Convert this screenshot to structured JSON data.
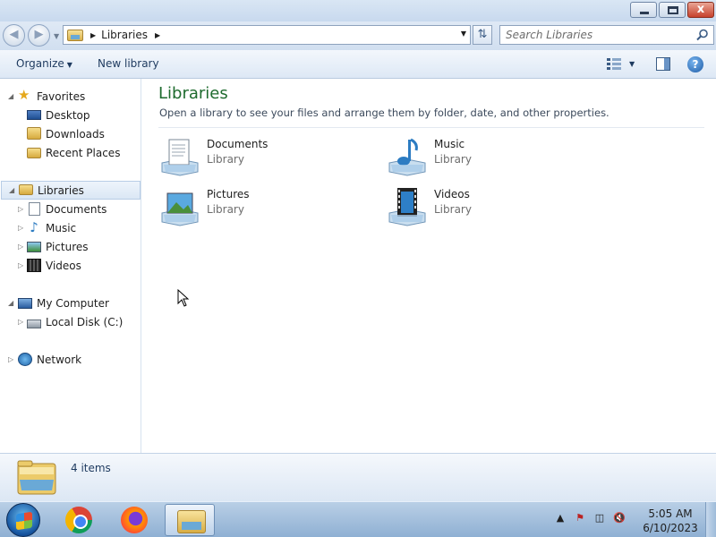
{
  "window": {
    "buttons": {
      "minimize": "",
      "maximize": "",
      "close": "x"
    }
  },
  "address_bar": {
    "path": "Libraries",
    "search_placeholder": "Search Libraries"
  },
  "toolbar": {
    "organize_label": "Organize",
    "new_library_label": "New library"
  },
  "nav_pane": {
    "favorites": {
      "label": "Favorites",
      "items": [
        "Desktop",
        "Downloads",
        "Recent Places"
      ]
    },
    "libraries": {
      "label": "Libraries",
      "items": [
        "Documents",
        "Music",
        "Pictures",
        "Videos"
      ]
    },
    "computer": {
      "label": "My Computer",
      "items": [
        "Local Disk (C:)"
      ]
    },
    "network": {
      "label": "Network"
    }
  },
  "content": {
    "title": "Libraries",
    "subtitle": "Open a library to see your files and arrange them by folder, date, and other properties.",
    "libraries": [
      {
        "name": "Documents",
        "type": "Library",
        "icon": "documents-library-icon"
      },
      {
        "name": "Music",
        "type": "Library",
        "icon": "music-library-icon"
      },
      {
        "name": "Pictures",
        "type": "Library",
        "icon": "pictures-library-icon"
      },
      {
        "name": "Videos",
        "type": "Library",
        "icon": "videos-library-icon"
      }
    ]
  },
  "details_pane": {
    "item_count": "4 items"
  },
  "taskbar": {
    "time": "5:05 AM",
    "date": "6/10/2023",
    "pinned": [
      "chrome-icon",
      "firefox-icon",
      "windows-explorer-icon"
    ]
  },
  "colors": {
    "title_green": "#1e6b2e",
    "selection_blue": "#dbe7f5",
    "taskbar_blue": "#8fb0d3"
  }
}
